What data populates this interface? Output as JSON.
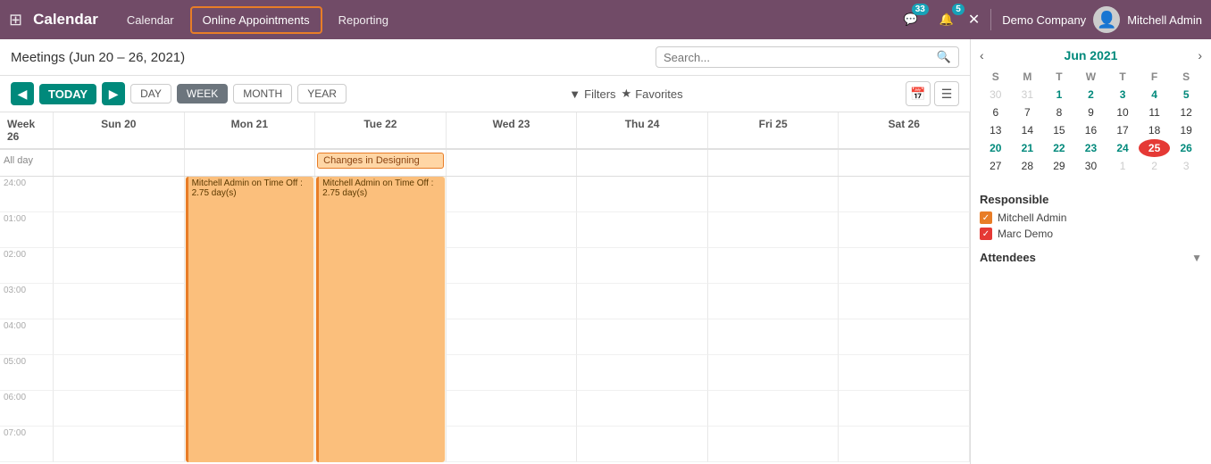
{
  "topnav": {
    "app_grid_icon": "⊞",
    "title": "Calendar",
    "nav_items": [
      {
        "label": "Calendar",
        "active": false
      },
      {
        "label": "Online Appointments",
        "active": true
      },
      {
        "label": "Reporting",
        "active": false
      }
    ],
    "badge1": {
      "icon": "💬",
      "count": "33"
    },
    "badge2": {
      "icon": "🔔",
      "count": "5"
    },
    "close_icon": "✕",
    "company": "Demo Company",
    "user_name": "Mitchell Admin"
  },
  "toolbar": {
    "meeting_title": "Meetings (Jun 20 – 26, 2021)",
    "search_placeholder": "Search..."
  },
  "controls": {
    "prev_icon": "◀",
    "today_label": "TODAY",
    "next_icon": "▶",
    "view_options": [
      "DAY",
      "WEEK",
      "MONTH",
      "YEAR"
    ],
    "active_view": "WEEK",
    "filter_label": "Filters",
    "favorites_label": "Favorites",
    "filter_icon": "▼",
    "star_icon": "★",
    "calendar_view_icon": "📅",
    "list_view_icon": "☰"
  },
  "calendar": {
    "header": [
      {
        "label": "Week 26"
      },
      {
        "label": "Sun 20"
      },
      {
        "label": "Mon 21"
      },
      {
        "label": "Tue 22"
      },
      {
        "label": "Wed 23"
      },
      {
        "label": "Thu 24"
      },
      {
        "label": "Fri 25"
      },
      {
        "label": "Sat 26"
      }
    ],
    "allday_label": "All day",
    "allday_events": [
      {
        "col": 3,
        "text": "Changes in Designing",
        "color_bg": "#FFEFD5",
        "color_border": "#E87D27"
      }
    ],
    "time_slots": [
      "24:00",
      "01:00",
      "02:00",
      "03:00",
      "04:00",
      "05:00",
      "06:00",
      "07:00"
    ],
    "time_events": [
      {
        "col": 3,
        "row_start": 0,
        "row_span": 8,
        "text": "Mitchell Admin on\nTime Off : 2.75 day(s)",
        "bg": "#FBBF7C",
        "border": "#E87D27"
      },
      {
        "col": 4,
        "row_start": 0,
        "row_span": 8,
        "text": "Mitchell Admin on\nTime Off : 2.75 day(s)",
        "bg": "#FBBF7C",
        "border": "#E87D27"
      }
    ]
  },
  "mini_cal": {
    "month_year": "Jun 2021",
    "prev_icon": "‹",
    "next_icon": "›",
    "day_headers": [
      "S",
      "M",
      "T",
      "W",
      "T",
      "F",
      "S"
    ],
    "weeks": [
      [
        {
          "day": "30",
          "other": true
        },
        {
          "day": "31",
          "other": true
        },
        {
          "day": "1",
          "current_week": true
        },
        {
          "day": "2",
          "current_week": true
        },
        {
          "day": "3",
          "current_week": true
        },
        {
          "day": "4",
          "current_week": true
        },
        {
          "day": "5",
          "current_week": true
        }
      ],
      [
        {
          "day": "6"
        },
        {
          "day": "7"
        },
        {
          "day": "8"
        },
        {
          "day": "9"
        },
        {
          "day": "10"
        },
        {
          "day": "11"
        },
        {
          "day": "12"
        }
      ],
      [
        {
          "day": "13"
        },
        {
          "day": "14"
        },
        {
          "day": "15"
        },
        {
          "day": "16"
        },
        {
          "day": "17"
        },
        {
          "day": "18"
        },
        {
          "day": "19"
        }
      ],
      [
        {
          "day": "20",
          "current_week": true
        },
        {
          "day": "21",
          "current_week": true
        },
        {
          "day": "22",
          "current_week": true
        },
        {
          "day": "23",
          "current_week": true
        },
        {
          "day": "24",
          "current_week": true
        },
        {
          "day": "25",
          "today": true
        },
        {
          "day": "26",
          "current_week": true
        }
      ],
      [
        {
          "day": "27"
        },
        {
          "day": "28"
        },
        {
          "day": "29"
        },
        {
          "day": "30"
        },
        {
          "day": "1",
          "other": true
        },
        {
          "day": "2",
          "other": true
        },
        {
          "day": "3",
          "other": true
        }
      ]
    ]
  },
  "responsible": {
    "title": "Responsible",
    "items": [
      {
        "label": "Mitchell Admin",
        "checked": true,
        "color": "orange"
      },
      {
        "label": "Marc Demo",
        "checked": true,
        "color": "red"
      }
    ]
  },
  "attendees": {
    "title": "Attendees",
    "chevron": "▼"
  }
}
